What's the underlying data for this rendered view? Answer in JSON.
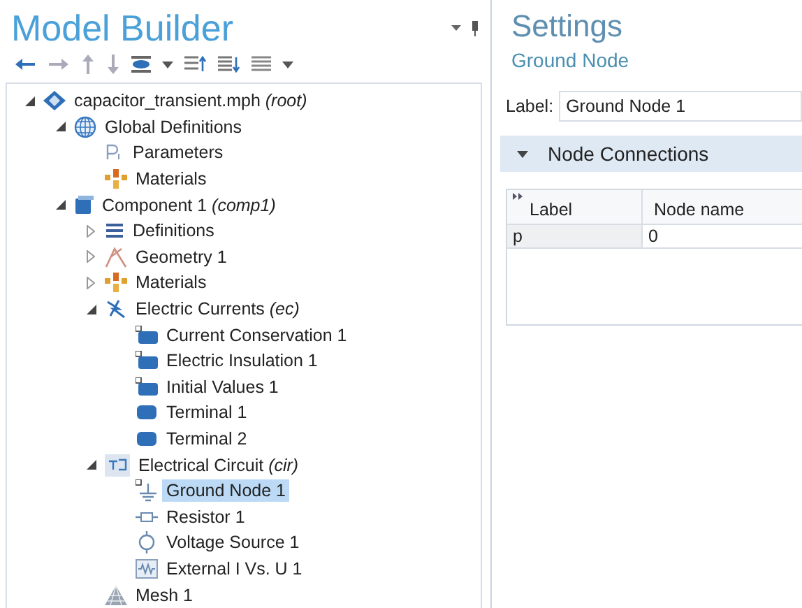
{
  "model_builder": {
    "title": "Model Builder",
    "tree": [
      {
        "label": "capacitor_transient.mph *(root)*",
        "kind": "model",
        "expanded": true,
        "selected": false,
        "children": [
          {
            "label": "Global Definitions",
            "kind": "globe",
            "expanded": true,
            "selected": false,
            "children": [
              {
                "label": "Parameters",
                "kind": "param",
                "selected": false
              },
              {
                "label": "Materials",
                "kind": "materials",
                "selected": false
              }
            ]
          },
          {
            "label": "Component 1 *(comp1)*",
            "kind": "component",
            "expanded": true,
            "selected": false,
            "children": [
              {
                "label": "Definitions",
                "kind": "list",
                "expanded": false,
                "selected": false
              },
              {
                "label": "Geometry 1",
                "kind": "geometry",
                "expanded": false,
                "selected": false
              },
              {
                "label": "Materials",
                "kind": "materials",
                "expanded": false,
                "selected": false
              },
              {
                "label": "Electric Currents *(ec)*",
                "kind": "physics",
                "expanded": true,
                "selected": false,
                "children": [
                  {
                    "label": "Current Conservation 1",
                    "kind": "feature",
                    "selected": false
                  },
                  {
                    "label": "Electric Insulation 1",
                    "kind": "feature",
                    "selected": false
                  },
                  {
                    "label": "Initial Values 1",
                    "kind": "feature",
                    "selected": false
                  },
                  {
                    "label": "Terminal 1",
                    "kind": "terminal",
                    "selected": false
                  },
                  {
                    "label": "Terminal 2",
                    "kind": "terminal",
                    "selected": false
                  }
                ]
              },
              {
                "label": "Electrical Circuit *(cir)*",
                "kind": "circuit",
                "expanded": true,
                "selected": false,
                "children": [
                  {
                    "label": "Ground Node 1",
                    "kind": "ground",
                    "selected": true
                  },
                  {
                    "label": "Resistor 1",
                    "kind": "resistor",
                    "selected": false
                  },
                  {
                    "label": "Voltage Source 1",
                    "kind": "source",
                    "selected": false
                  },
                  {
                    "label": "External I Vs. U 1",
                    "kind": "external",
                    "selected": false
                  }
                ]
              },
              {
                "label": "Mesh 1",
                "kind": "mesh",
                "selected": false
              }
            ]
          }
        ]
      }
    ]
  },
  "settings": {
    "title": "Settings",
    "subtitle": "Ground Node",
    "label_caption": "Label:",
    "label_value": "Ground Node 1",
    "section": {
      "title": "Node Connections",
      "expanded": true,
      "table": {
        "columns": [
          "Label",
          "Node name"
        ],
        "rows": [
          [
            "p",
            "0"
          ]
        ]
      }
    }
  }
}
